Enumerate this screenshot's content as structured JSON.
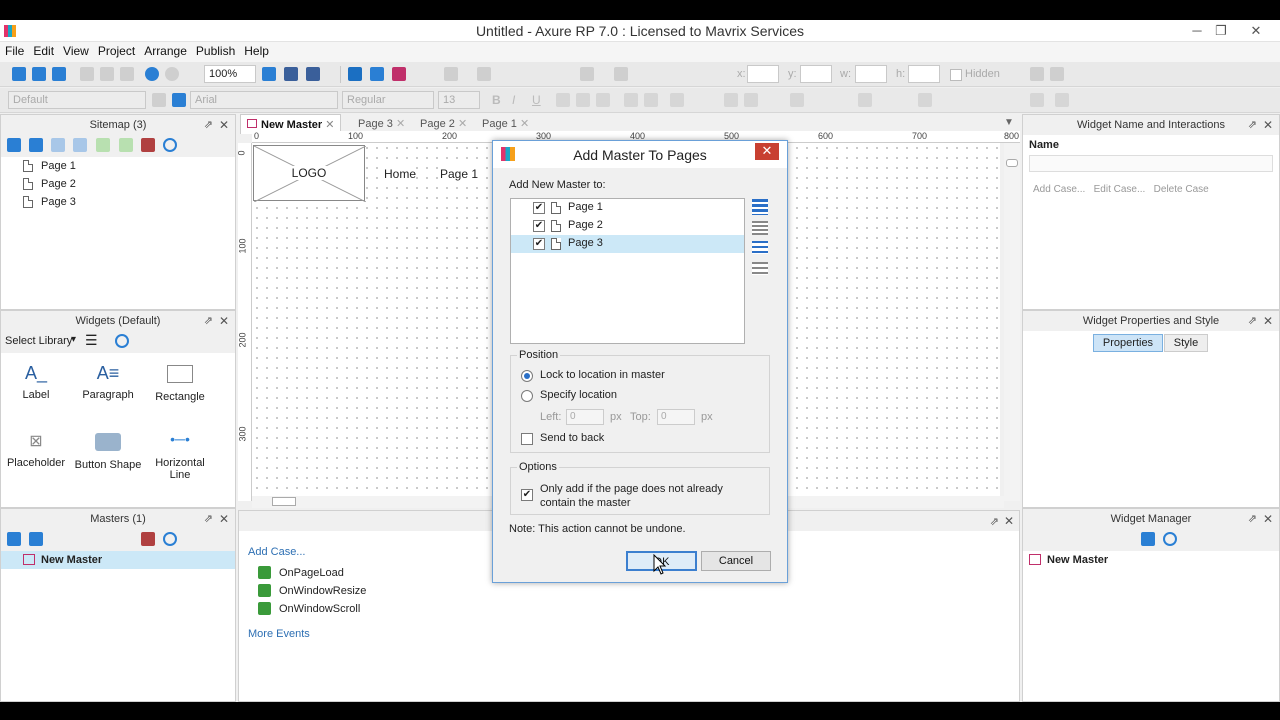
{
  "window": {
    "title": "Untitled - Axure RP 7.0 : Licensed to Mavrix Services"
  },
  "menu": [
    "File",
    "Edit",
    "View",
    "Project",
    "Arrange",
    "Publish",
    "Help"
  ],
  "toolbar": {
    "zoom": "100%",
    "style_default": "Default",
    "font": "Arial",
    "font_style": "Regular",
    "font_size": "13",
    "x_label": "x:",
    "y_label": "y:",
    "w_label": "w:",
    "h_label": "h:",
    "hidden_label": "Hidden"
  },
  "sitemap": {
    "title": "Sitemap (3)",
    "pages": [
      "Page 1",
      "Page 2",
      "Page 3"
    ]
  },
  "widgets": {
    "title": "Widgets (Default)",
    "library_label": "Select Library",
    "items": [
      "Label",
      "Paragraph",
      "Rectangle",
      "Placeholder",
      "Button Shape",
      "Horizontal Line"
    ]
  },
  "masters": {
    "title": "Masters (1)",
    "items": [
      "New Master"
    ]
  },
  "tabs": [
    "New Master",
    "Page 3",
    "Page 2",
    "Page 1"
  ],
  "ruler": {
    "h_ticks": [
      "0",
      "100",
      "200",
      "300",
      "400",
      "500",
      "600",
      "700",
      "800"
    ],
    "v_ticks": [
      "0",
      "100",
      "200",
      "300"
    ]
  },
  "canvas": {
    "logo_label": "LOGO",
    "nav": [
      "Home",
      "Page 1"
    ]
  },
  "interactions": {
    "add_case": "Add Case...",
    "events": [
      "OnPageLoad",
      "OnWindowResize",
      "OnWindowScroll"
    ],
    "more_events": "More Events"
  },
  "right_panel": {
    "widget_name_title": "Widget Name and Interactions",
    "name_label": "Name",
    "add_case": "Add Case...",
    "edit_case": "Edit Case...",
    "delete_case": "Delete Case",
    "props_title": "Widget Properties and Style",
    "properties_tab": "Properties",
    "style_tab": "Style",
    "manager_title": "Widget Manager",
    "manager_items": [
      "New Master"
    ]
  },
  "dialog": {
    "title": "Add Master To Pages",
    "add_to_label": "Add New Master to:",
    "pages": [
      "Page 1",
      "Page 2",
      "Page 3"
    ],
    "position_label": "Position",
    "lock_label": "Lock to location in master",
    "specify_label": "Specify location",
    "left_label": "Left:",
    "left_value": "0",
    "px1": "px",
    "top_label": "Top:",
    "top_value": "0",
    "px2": "px",
    "send_back_label": "Send to back",
    "options_label": "Options",
    "only_add_label_1": "Only add if the page does not already",
    "only_add_label_2": "contain the master",
    "note": "Note: This action cannot be undone.",
    "ok": "OK",
    "cancel": "Cancel"
  },
  "colors": {
    "accent": "#2a6fc7",
    "selection": "#cce8f7",
    "close_red": "#c84031"
  }
}
